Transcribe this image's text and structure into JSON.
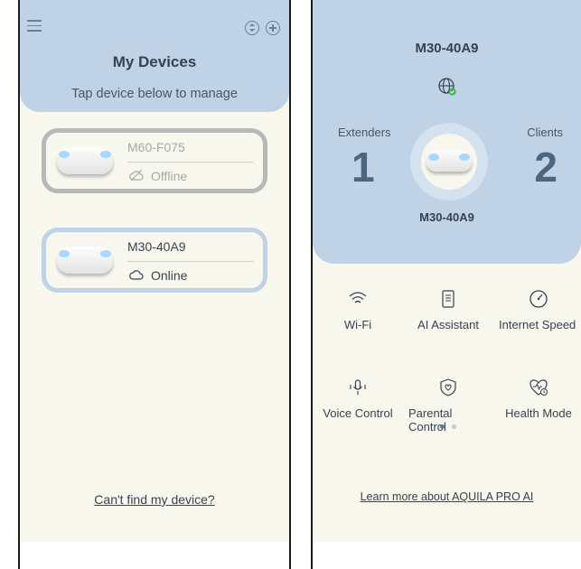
{
  "left_screen": {
    "header": {
      "title": "My Devices",
      "subtitle": "Tap device below to manage"
    },
    "devices": [
      {
        "name": "M60-F075",
        "status": "Offline"
      },
      {
        "name": "M30-40A9",
        "status": "Online"
      }
    ],
    "find_link": "Can't find my device?"
  },
  "right_screen": {
    "title": "M30-40A9",
    "extenders": {
      "label": "Extenders",
      "value": "1"
    },
    "clients": {
      "label": "Clients",
      "value": "2"
    },
    "center_device": "M30-40A9",
    "features": [
      {
        "label": "Wi-Fi",
        "icon": "wifi-icon"
      },
      {
        "label": "AI Assistant",
        "icon": "ai-assistant-icon"
      },
      {
        "label": "Internet Speed",
        "icon": "speed-gauge-icon"
      },
      {
        "label": "Voice Control",
        "icon": "voice-control-icon"
      },
      {
        "label": "Parental Control",
        "icon": "parental-shield-icon"
      },
      {
        "label": "Health Mode",
        "icon": "health-heart-icon"
      }
    ],
    "pager": {
      "pages": 2,
      "active": 1
    },
    "learn_link": "Learn more about AQUILA PRO AI"
  },
  "colors": {
    "header_blue": "#bfd2e6",
    "background": "#f8f7ee",
    "stat_number": "#4d6680",
    "online_badge": "#3fae5a",
    "offline_border": "#b8b8b8"
  }
}
